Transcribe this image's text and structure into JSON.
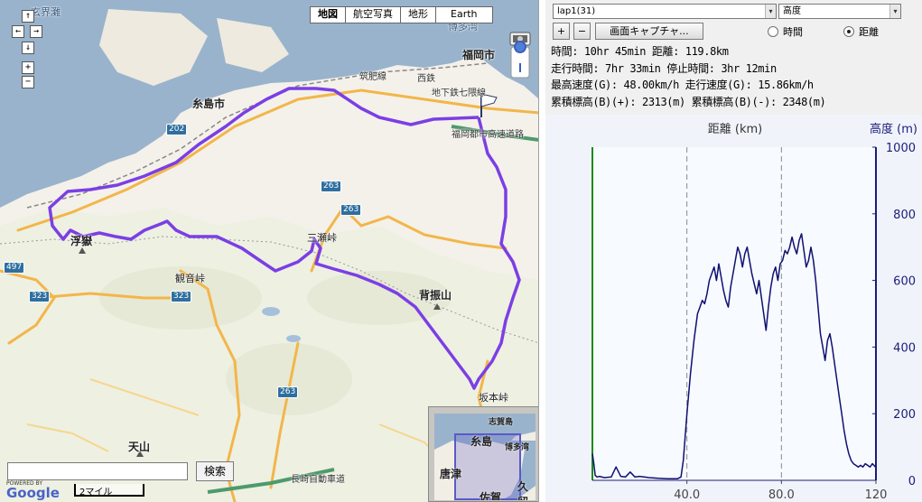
{
  "map": {
    "map_types": [
      "地図",
      "航空写真",
      "地形",
      "Earth"
    ],
    "labels": {
      "genkainada": "玄界灘",
      "itoshima": "糸島市",
      "fukuoka": "福岡市",
      "hakata": "博多湾",
      "chikuhi_line": "筑肥線",
      "nishitetsu": "西鉄",
      "jikata_line": "地下鉄七隈線",
      "sanzekami": "三瀬峠",
      "sefuri": "背振山",
      "ukidake": "浮嶽",
      "kannon": "観音峠",
      "tenzan": "天山",
      "sakamoto": "坂本峠",
      "nagasaki_exp": "長崎自動車道",
      "fukuoka_exp": "福岡都市高速道路"
    },
    "shields": [
      "202",
      "263",
      "263",
      "323",
      "323",
      "263",
      "497"
    ],
    "search_placeholder": "",
    "search_button": "検索",
    "scale_label": "2マイル",
    "logo_text": "Google",
    "logo_powered": "POWERED BY",
    "overview_labels": [
      "糸島",
      "唐津",
      "佐賀",
      "博多湾",
      "志賀島",
      "久留"
    ]
  },
  "panel": {
    "lap_select": "lap1(31)",
    "y_select": "高度",
    "zoom_in": "+",
    "zoom_out": "−",
    "capture_button": "画面キャプチャ...",
    "radio_time": "時間",
    "radio_distance": "距離",
    "stats": [
      "時間: 10hr 45min 距離: 119.8km",
      "走行時間: 7hr 33min 停止時間: 3hr 12min",
      "最高速度(G): 48.00km/h 走行速度(G): 15.86km/h",
      "累積標高(B)(+): 2313(m) 累積標高(B)(-): 2348(m)"
    ]
  },
  "chart_data": {
    "type": "line",
    "xlabel": "距離 (km)",
    "ylabel": "高度 (m)",
    "xlim": [
      0,
      120
    ],
    "ylim": [
      0,
      1000
    ],
    "xticks": [
      "40.0",
      "80.0",
      "120"
    ],
    "yticks": [
      "0",
      "200",
      "400",
      "600",
      "800",
      "1000"
    ],
    "series": [
      {
        "name": "高度",
        "color": "#101070",
        "x": [
          0,
          0.6,
          1.2,
          2,
          3,
          5,
          8,
          10,
          12,
          14,
          16,
          18,
          20,
          24,
          28,
          32,
          36,
          37.5,
          38.5,
          40,
          41.5,
          43,
          44.5,
          45.5,
          46.5,
          47.5,
          48.5,
          49.5,
          50.5,
          51.5,
          52.5,
          53.5,
          54.5,
          55.5,
          56.5,
          57.5,
          58.5,
          59.5,
          60.5,
          61.5,
          62.5,
          63.5,
          64.5,
          65.5,
          66.5,
          67.5,
          68.5,
          69.5,
          70.5,
          71.5,
          72.5,
          73.5,
          74.5,
          75.5,
          76.5,
          77.5,
          78.5,
          79.5,
          80.5,
          81.5,
          82.5,
          83.5,
          84.5,
          85.5,
          86.5,
          87.5,
          88.5,
          89.5,
          90.5,
          91.5,
          92.5,
          93.5,
          94.5,
          95.5,
          96.5,
          97.5,
          98.5,
          99.5,
          100.5,
          101.5,
          102.5,
          103.5,
          104.5,
          105.5,
          106.5,
          107.5,
          108.5,
          109.5,
          110.5,
          111.5,
          112.5,
          113.5,
          114.5,
          115.5,
          116.5,
          117.5,
          118.5,
          119.8
        ],
        "y": [
          80,
          50,
          15,
          10,
          12,
          8,
          10,
          40,
          12,
          10,
          25,
          10,
          12,
          8,
          6,
          5,
          5,
          10,
          60,
          200,
          320,
          420,
          500,
          520,
          540,
          530,
          560,
          600,
          620,
          640,
          600,
          650,
          610,
          570,
          540,
          520,
          580,
          620,
          660,
          700,
          680,
          640,
          680,
          700,
          660,
          620,
          590,
          560,
          600,
          550,
          500,
          450,
          520,
          580,
          620,
          640,
          600,
          650,
          660,
          690,
          680,
          700,
          730,
          700,
          680,
          720,
          740,
          690,
          640,
          660,
          700,
          660,
          600,
          520,
          440,
          400,
          360,
          420,
          440,
          400,
          350,
          300,
          250,
          200,
          150,
          110,
          80,
          60,
          50,
          45,
          40,
          45,
          40,
          50,
          45,
          40,
          50,
          40
        ]
      }
    ],
    "vlines_x": [
      40,
      80
    ],
    "grid": true
  }
}
